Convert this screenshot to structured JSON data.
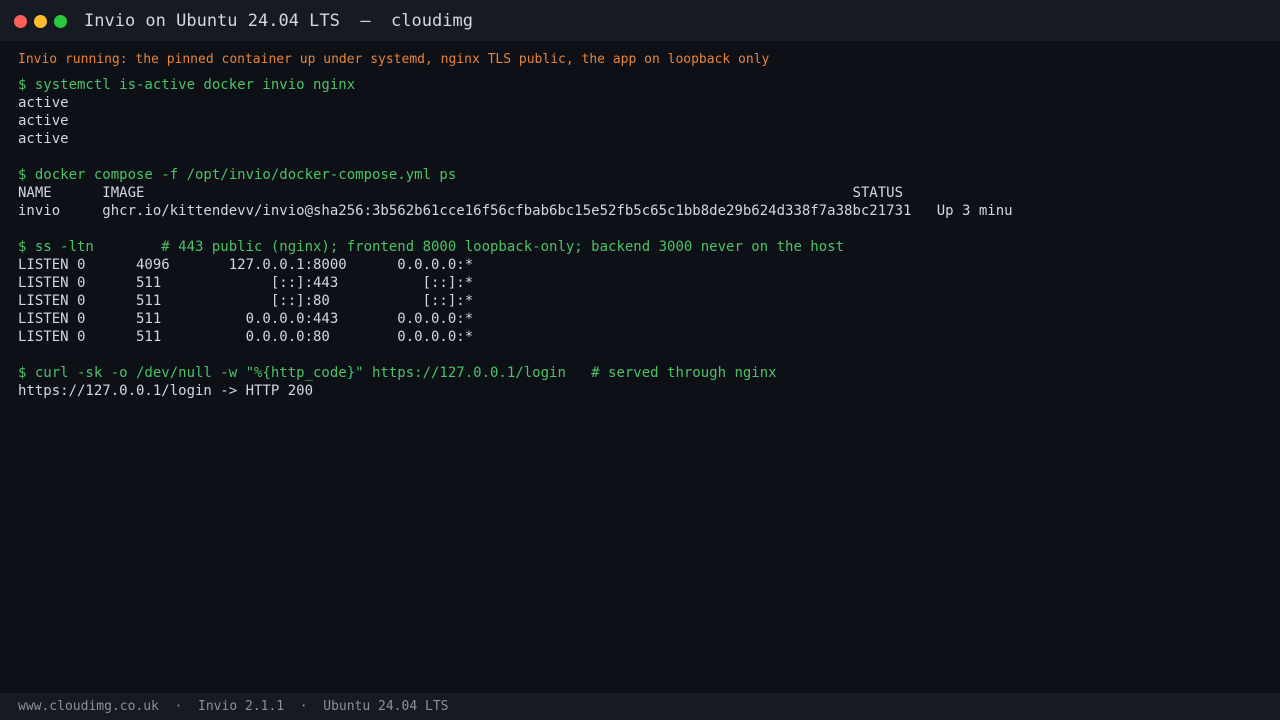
{
  "window": {
    "title": "Invio on Ubuntu 24.04 LTS  —  cloudimg"
  },
  "terminal": {
    "banner": "Invio running: the pinned container up under systemd, nginx TLS public, the app on loopback only",
    "lines": [
      {
        "type": "cmd",
        "text": "$ systemctl is-active docker invio nginx"
      },
      {
        "type": "out",
        "text": "active"
      },
      {
        "type": "out",
        "text": "active"
      },
      {
        "type": "out",
        "text": "active"
      },
      {
        "type": "blank",
        "text": ""
      },
      {
        "type": "cmd",
        "text": "$ docker compose -f /opt/invio/docker-compose.yml ps"
      },
      {
        "type": "out",
        "text": "NAME      IMAGE                                                                                    STATUS"
      },
      {
        "type": "out",
        "text": "invio     ghcr.io/kittendevv/invio@sha256:3b562b61cce16f56cfbab6bc15e52fb5c65c1bb8de29b624d338f7a38bc21731   Up 3 minu"
      },
      {
        "type": "blank",
        "text": ""
      },
      {
        "type": "cmd",
        "text": "$ ss -ltn        # 443 public (nginx); frontend 8000 loopback-only; backend 3000 never on the host"
      },
      {
        "type": "out",
        "text": "LISTEN 0      4096       127.0.0.1:8000      0.0.0.0:*"
      },
      {
        "type": "out",
        "text": "LISTEN 0      511             [::]:443          [::]:*"
      },
      {
        "type": "out",
        "text": "LISTEN 0      511             [::]:80           [::]:*"
      },
      {
        "type": "out",
        "text": "LISTEN 0      511          0.0.0.0:443       0.0.0.0:*"
      },
      {
        "type": "out",
        "text": "LISTEN 0      511          0.0.0.0:80        0.0.0.0:*"
      },
      {
        "type": "blank",
        "text": ""
      },
      {
        "type": "cmd",
        "text": "$ curl -sk -o /dev/null -w \"%{http_code}\" https://127.0.0.1/login   # served through nginx"
      },
      {
        "type": "out",
        "text": "https://127.0.0.1/login -> HTTP 200"
      }
    ]
  },
  "statusbar": {
    "text": "www.cloudimg.co.uk  ·  Invio 2.1.1  ·  Ubuntu 24.04 LTS"
  },
  "colors": {
    "background": "#0d1017",
    "titlebar": "#161a23",
    "command": "#4cc265",
    "banner": "#e8843a",
    "output": "#d3d7de",
    "muted": "#8a909c"
  }
}
